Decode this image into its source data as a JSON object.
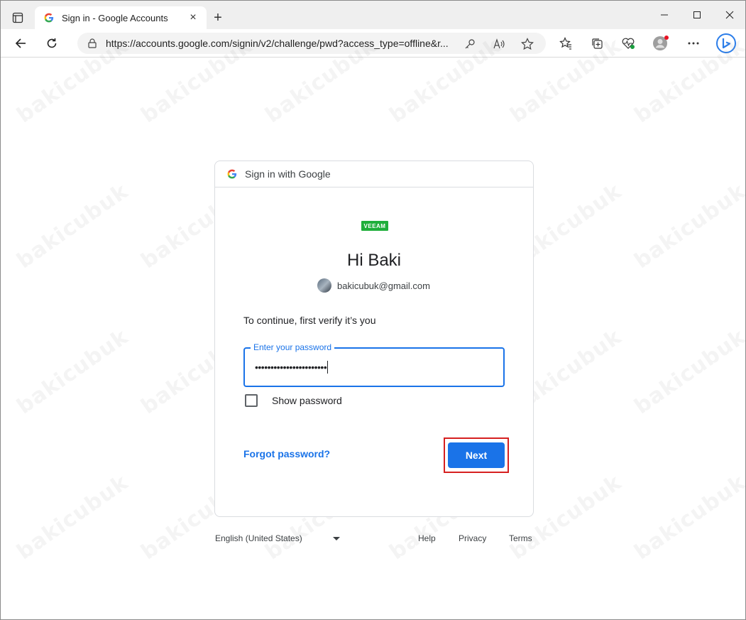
{
  "browser": {
    "tab": {
      "title": "Sign in - Google Accounts",
      "close": "×"
    },
    "newtab": "+",
    "address": {
      "url": "https://accounts.google.com/signin/v2/challenge/pwd?access_type=offline&r..."
    }
  },
  "card": {
    "header": "Sign in with Google",
    "brand": "VEEAM",
    "greeting": "Hi Baki",
    "email": "bakicubuk@gmail.com",
    "verify_text": "To continue, first verify it’s you",
    "password": {
      "label": "Enter your password",
      "masked_value": "•••••••••••••••••••••••"
    },
    "show_password_label": "Show password",
    "forgot_label": "Forgot password?",
    "next_label": "Next"
  },
  "footer": {
    "language": "English (United States)",
    "help": "Help",
    "privacy": "Privacy",
    "terms": "Terms"
  },
  "watermark": "bakicubuk",
  "colors": {
    "primary": "#1a73e8",
    "highlight": "#d62020",
    "veeam": "#1fae3a"
  }
}
